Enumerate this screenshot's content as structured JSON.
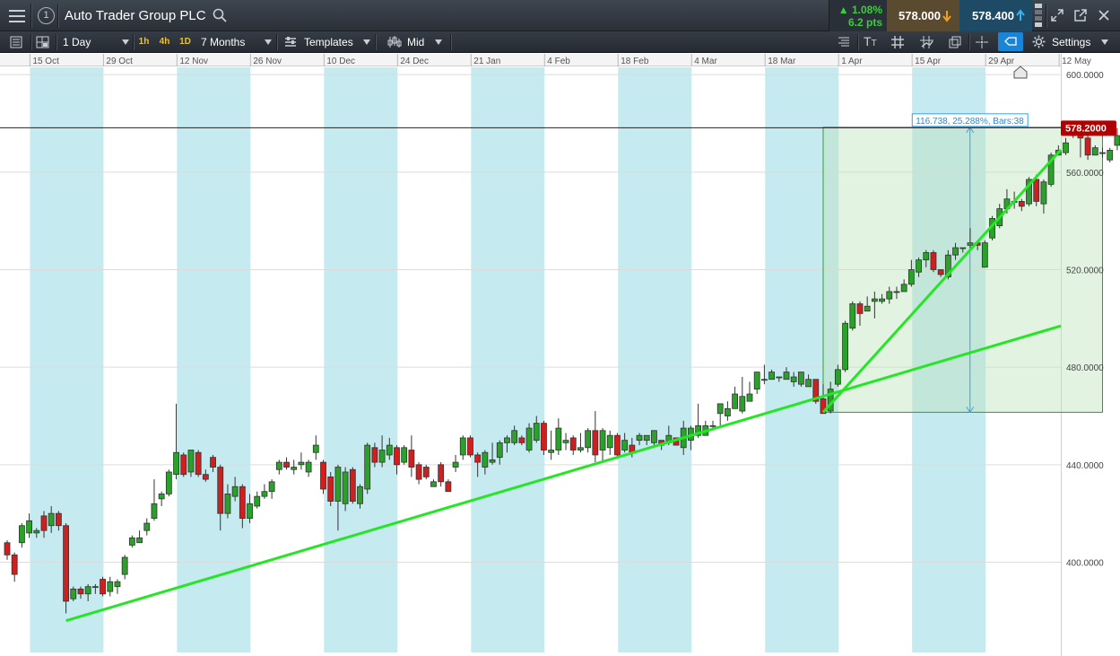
{
  "toolbar": {
    "instrument": "Auto Trader Group PLC",
    "window_number": "1",
    "change_pct": "1.08%",
    "change_pts": "6.2 pts",
    "sell_price": "578.000",
    "buy_price": "578.400",
    "interval": "1 Day",
    "tf_1h": "1h",
    "tf_4h": "4h",
    "tf_1d": "1D",
    "range": "7 Months",
    "templates": "Templates",
    "price_type": "Mid",
    "settings": "Settings",
    "text_tool": "T"
  },
  "colors": {
    "up": "#2ba02b",
    "down": "#cf1f1f",
    "trendline": "#26e526",
    "band": "#c5eaf0",
    "measure_fill": "#bfe5bf",
    "price_label": "#b00000"
  },
  "chart_data": {
    "type": "candlestick",
    "x_ticks": [
      "15 Oct",
      "29 Oct",
      "12 Nov",
      "26 Nov",
      "10 Dec",
      "24 Dec",
      "21 Jan",
      "4 Feb",
      "18 Feb",
      "4 Mar",
      "18 Mar",
      "1 Apr",
      "15 Apr",
      "29 Apr",
      "12 May"
    ],
    "y_ticks": [
      "600.0000",
      "560.0000",
      "520.0000",
      "480.0000",
      "440.0000",
      "400.0000"
    ],
    "ylim": [
      363,
      603
    ],
    "current_price": "578.2000",
    "measure_label": "116.738, 25.288%, Bars:38",
    "measure": {
      "start_bar": 111,
      "end_bar": 149,
      "low": 461.5,
      "high": 578.4
    },
    "trendlines": [
      {
        "from": [
          8,
          376.0
        ],
        "to": [
          149,
          502.0
        ]
      },
      {
        "from": [
          111,
          461.5
        ],
        "to": [
          149,
          588.0
        ]
      }
    ],
    "candles": [
      [
        408,
        403,
        409,
        401
      ],
      [
        403,
        395,
        404,
        392
      ],
      [
        408,
        415,
        416,
        406
      ],
      [
        412,
        417,
        420,
        410
      ],
      [
        412,
        413,
        414,
        410
      ],
      [
        419,
        413,
        421,
        410
      ],
      [
        415,
        420,
        423,
        412
      ],
      [
        420,
        415,
        421,
        413
      ],
      [
        415,
        384,
        416,
        379
      ],
      [
        385,
        389,
        390,
        384
      ],
      [
        389,
        387,
        390,
        385
      ],
      [
        387,
        390,
        391,
        384
      ],
      [
        390,
        390,
        391,
        387
      ],
      [
        393,
        387,
        394,
        386
      ],
      [
        388,
        392,
        394,
        386
      ],
      [
        390,
        392,
        393,
        387
      ],
      [
        395,
        402,
        403,
        393
      ],
      [
        407,
        410,
        411,
        406
      ],
      [
        408,
        410,
        413,
        408
      ],
      [
        413,
        416,
        418,
        411
      ],
      [
        418,
        424,
        434,
        417
      ],
      [
        426,
        428,
        429,
        423
      ],
      [
        428,
        437,
        438,
        427
      ],
      [
        436,
        445,
        465,
        434
      ],
      [
        444,
        436,
        445,
        435
      ],
      [
        437,
        446,
        446,
        435
      ],
      [
        445,
        436,
        446,
        435
      ],
      [
        436,
        434,
        438,
        433
      ],
      [
        443,
        439,
        444,
        437
      ],
      [
        439,
        420,
        440,
        413
      ],
      [
        420,
        428,
        432,
        418
      ],
      [
        427,
        431,
        435,
        425
      ],
      [
        431,
        418,
        432,
        414
      ],
      [
        418,
        424,
        428,
        416
      ],
      [
        423,
        427,
        429,
        422
      ],
      [
        427,
        429,
        432,
        426
      ],
      [
        429,
        433,
        434,
        426
      ],
      [
        438,
        441,
        442,
        436
      ],
      [
        441,
        439,
        443,
        438
      ],
      [
        438,
        439,
        442,
        436
      ],
      [
        440,
        441,
        445,
        438
      ],
      [
        437,
        441,
        442,
        435
      ],
      [
        445,
        448,
        452,
        442
      ],
      [
        441,
        430,
        442,
        428
      ],
      [
        435,
        425,
        437,
        423
      ],
      [
        425,
        439,
        440,
        413
      ],
      [
        424,
        437,
        439,
        421
      ],
      [
        438,
        425,
        439,
        424
      ],
      [
        424,
        431,
        432,
        422
      ],
      [
        430,
        448,
        449,
        428
      ],
      [
        447,
        441,
        449,
        439
      ],
      [
        441,
        446,
        452,
        439
      ],
      [
        444,
        448,
        451,
        442
      ],
      [
        447,
        440,
        448,
        436
      ],
      [
        441,
        447,
        448,
        440
      ],
      [
        446,
        439,
        452,
        435
      ],
      [
        440,
        434,
        441,
        432
      ],
      [
        439,
        435,
        440,
        434
      ],
      [
        431,
        433,
        434,
        431
      ],
      [
        440,
        433,
        441,
        431
      ],
      [
        433,
        429,
        434,
        429
      ],
      [
        439,
        441,
        444,
        437
      ],
      [
        444,
        451,
        452,
        442
      ],
      [
        451,
        444,
        452,
        443
      ],
      [
        444,
        441,
        445,
        435
      ],
      [
        439,
        445,
        446,
        436
      ],
      [
        441,
        442,
        449,
        440
      ],
      [
        443,
        449,
        450,
        440
      ],
      [
        449,
        451,
        452,
        445
      ],
      [
        449,
        454,
        456,
        448
      ],
      [
        451,
        449,
        452,
        448
      ],
      [
        446,
        455,
        457,
        445
      ],
      [
        450,
        457,
        460,
        449
      ],
      [
        457,
        446,
        458,
        444
      ],
      [
        445,
        446,
        454,
        442
      ],
      [
        446,
        455,
        459,
        444
      ],
      [
        449,
        450,
        453,
        446
      ],
      [
        451,
        446,
        452,
        444
      ],
      [
        446,
        447,
        453,
        445
      ],
      [
        447,
        454,
        455,
        445
      ],
      [
        454,
        444,
        462,
        441
      ],
      [
        446,
        454,
        455,
        441
      ],
      [
        447,
        452,
        454,
        444
      ],
      [
        452,
        444,
        453,
        443
      ],
      [
        446,
        450,
        453,
        445
      ],
      [
        448,
        445,
        451,
        443
      ],
      [
        450,
        452,
        453,
        448
      ],
      [
        450,
        452,
        452,
        448
      ],
      [
        449,
        454,
        454,
        447
      ],
      [
        450,
        448,
        450,
        446
      ],
      [
        449,
        452,
        456,
        448
      ],
      [
        451,
        448,
        451,
        448
      ],
      [
        447,
        455,
        458,
        444
      ],
      [
        450,
        455,
        456,
        446
      ],
      [
        452,
        456,
        465,
        451
      ],
      [
        452,
        456,
        458,
        452
      ],
      [
        456,
        456,
        458,
        454
      ],
      [
        461,
        465,
        465,
        456
      ],
      [
        460,
        463,
        466,
        458
      ],
      [
        463,
        469,
        472,
        463
      ],
      [
        462,
        468,
        476,
        461
      ],
      [
        466,
        469,
        474,
        466
      ],
      [
        471,
        478,
        478,
        469
      ],
      [
        475,
        475,
        481,
        473
      ],
      [
        475,
        478,
        479,
        475
      ],
      [
        476,
        476,
        476,
        474
      ],
      [
        475,
        478,
        480,
        475
      ],
      [
        474,
        476,
        478,
        472
      ],
      [
        473,
        478,
        478,
        472
      ],
      [
        472,
        475,
        477,
        472
      ],
      [
        475,
        466,
        475,
        465
      ],
      [
        467,
        461,
        473,
        461
      ],
      [
        462,
        471,
        474,
        461
      ],
      [
        473,
        479,
        481,
        472
      ],
      [
        479,
        498,
        499,
        478
      ],
      [
        496,
        506,
        507,
        495
      ],
      [
        506,
        502,
        507,
        497
      ],
      [
        503,
        505,
        509,
        503
      ],
      [
        507,
        508,
        511,
        500
      ],
      [
        507,
        508,
        510,
        506
      ],
      [
        508,
        511,
        513,
        506
      ],
      [
        511,
        511,
        513,
        508
      ],
      [
        511,
        514,
        516,
        512
      ],
      [
        514,
        520,
        524,
        513
      ],
      [
        519,
        524,
        525,
        517
      ],
      [
        524,
        527,
        528,
        521
      ],
      [
        527,
        520,
        528,
        519
      ],
      [
        520,
        518,
        520,
        517
      ],
      [
        517,
        526,
        528,
        516
      ],
      [
        526,
        529,
        531,
        524
      ],
      [
        529,
        529,
        529,
        527
      ],
      [
        530,
        531,
        537,
        528
      ],
      [
        531,
        530,
        532,
        528
      ],
      [
        521,
        531,
        532,
        521
      ],
      [
        533,
        541,
        542,
        532
      ],
      [
        538,
        545,
        547,
        537
      ],
      [
        545,
        549,
        553,
        543
      ],
      [
        548,
        548,
        552,
        545
      ],
      [
        548,
        546,
        549,
        544
      ],
      [
        547,
        557,
        558,
        546
      ],
      [
        557,
        548,
        559,
        546
      ],
      [
        547,
        556,
        557,
        543
      ],
      [
        555,
        567,
        568,
        554
      ],
      [
        567,
        569,
        571,
        567
      ],
      [
        568,
        572,
        574,
        567
      ],
      [
        575,
        578,
        581,
        574
      ],
      [
        578,
        574,
        578,
        566
      ],
      [
        574,
        567,
        576,
        565
      ],
      [
        567,
        570,
        571,
        567
      ],
      [
        568,
        568,
        570,
        566
      ],
      [
        565,
        569,
        570,
        564
      ],
      [
        571,
        575,
        578,
        569
      ],
      [
        571,
        575,
        579,
        571
      ],
      [
        578,
        570,
        584,
        569
      ],
      [
        572,
        577,
        579,
        570
      ]
    ]
  }
}
